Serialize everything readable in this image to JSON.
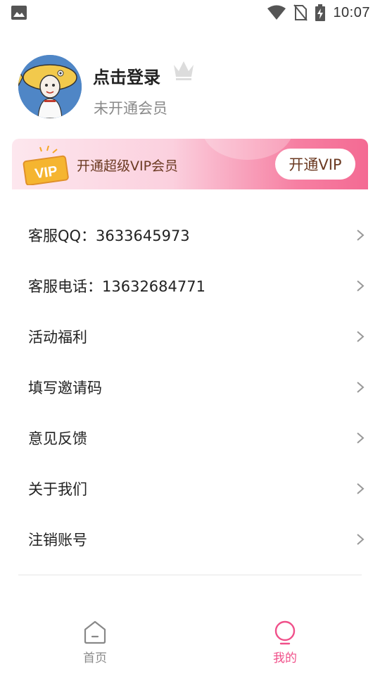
{
  "status_bar": {
    "time": "10:07",
    "icons": [
      "gallery-icon",
      "wifi-icon",
      "no-sim-icon",
      "battery-charging-icon"
    ]
  },
  "profile": {
    "login_title": "点击登录",
    "member_status": "未开通会员",
    "badge_icon": "crown-icon"
  },
  "vip_banner": {
    "tag_text": "VIP",
    "text": "开通超级VIP会员",
    "button_label": "开通VIP"
  },
  "menu": {
    "items": [
      {
        "label": "客服QQ：3633645973"
      },
      {
        "label": "客服电话：13632684771"
      },
      {
        "label": "活动福利"
      },
      {
        "label": "填写邀请码"
      },
      {
        "label": "意见反馈"
      },
      {
        "label": "关于我们"
      },
      {
        "label": "注销账号"
      }
    ]
  },
  "bottom_nav": {
    "items": [
      {
        "label": "首页",
        "icon": "home-icon",
        "active": false
      },
      {
        "label": "我的",
        "icon": "profile-icon",
        "active": true
      }
    ]
  },
  "colors": {
    "accent": "#f0508a",
    "vip_text": "#6b3a22",
    "inactive": "#8a8a8a"
  }
}
